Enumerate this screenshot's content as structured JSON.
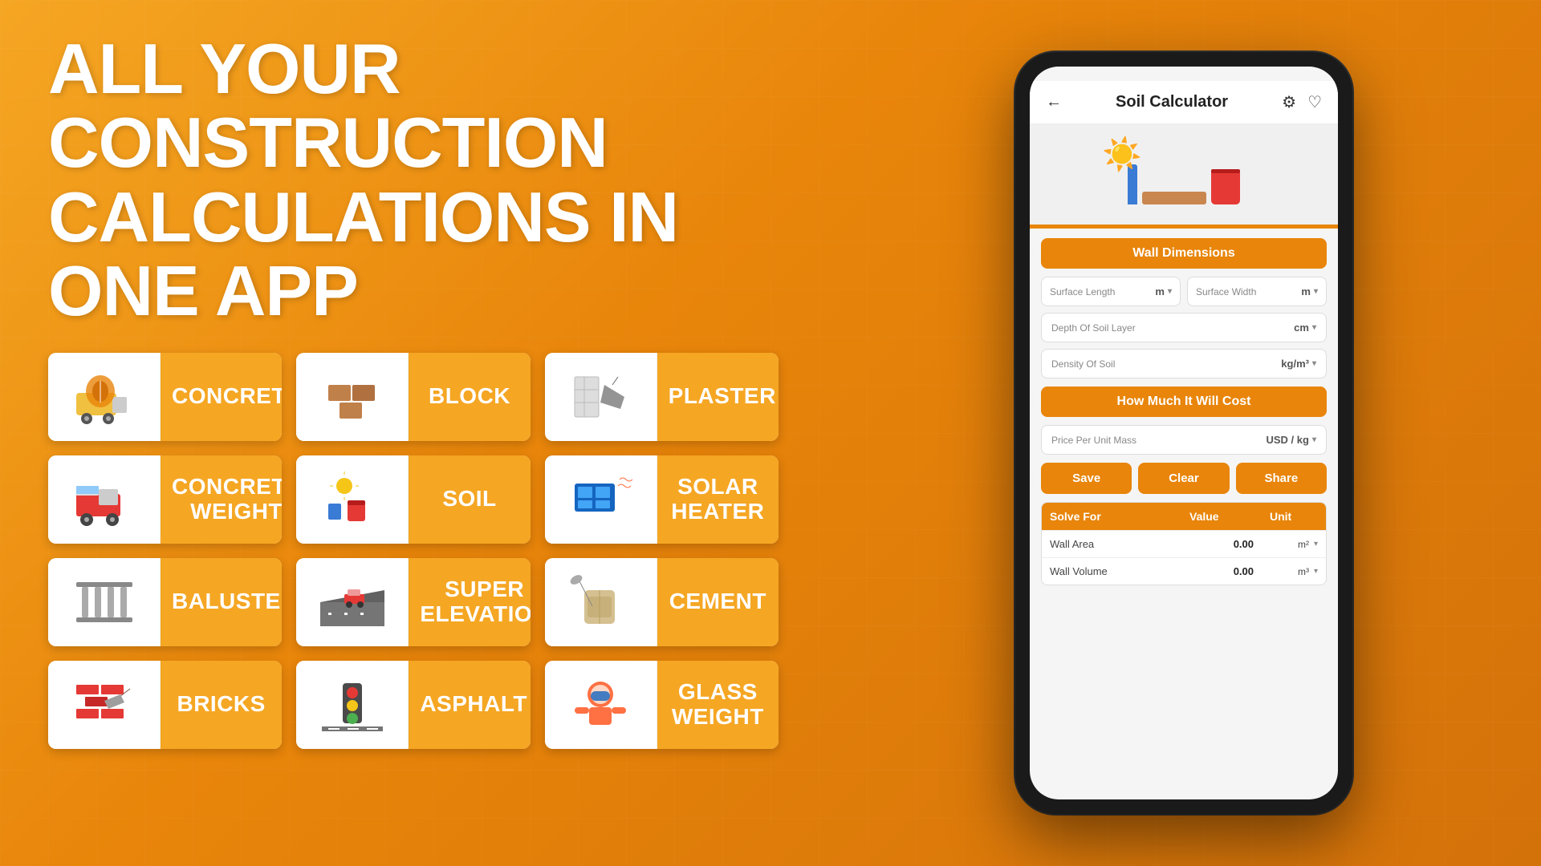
{
  "headline": {
    "line1": "ALL YOUR CONSTRUCTION",
    "line2": "CALCULATIONS IN ONE APP"
  },
  "cards": [
    {
      "id": "concrete",
      "label": "CONCRETE",
      "icon": "🏗️"
    },
    {
      "id": "block",
      "label": "BLOCK",
      "icon": "🧱"
    },
    {
      "id": "plaster",
      "label": "PLASTER",
      "icon": "🪣"
    },
    {
      "id": "concrete-weight",
      "label": "CONCRETE WEIGHT",
      "icon": "🚛"
    },
    {
      "id": "soil",
      "label": "SOIL",
      "icon": "🏺"
    },
    {
      "id": "solar-heater",
      "label": "SOLAR HEATER",
      "icon": "☀️"
    },
    {
      "id": "baluster",
      "label": "BALUSTER",
      "icon": "🚧"
    },
    {
      "id": "super-elevation",
      "label": "SUPER ELEVATION",
      "icon": "🛣️"
    },
    {
      "id": "cement",
      "label": "CEMENT",
      "icon": "💰"
    },
    {
      "id": "bricks",
      "label": "BRICKS",
      "icon": "🧱"
    },
    {
      "id": "asphalt",
      "label": "ASPHALT",
      "icon": "🚦"
    },
    {
      "id": "glass-weight",
      "label": "GLASS WEIGHT",
      "icon": "🪟"
    }
  ],
  "phone": {
    "title": "Soil Calculator",
    "back_icon": "←",
    "settings_icon": "⚙",
    "heart_icon": "♡",
    "wall_dimensions_label": "Wall Dimensions",
    "surface_length_placeholder": "Surface Length",
    "surface_length_unit": "m",
    "surface_width_placeholder": "Surface Width",
    "surface_width_unit": "m",
    "depth_of_soil_placeholder": "Depth Of Soil Layer",
    "depth_of_soil_unit": "cm",
    "density_of_soil_placeholder": "Density Of Soil",
    "density_of_soil_unit": "kg/m³",
    "how_much_label": "How Much It Will Cost",
    "price_per_unit_placeholder": "Price Per Unit Mass",
    "price_per_unit_unit": "USD / kg",
    "save_btn": "Save",
    "clear_btn": "Clear",
    "share_btn": "Share",
    "results_header": {
      "solve_for": "Solve For",
      "value": "Value",
      "unit": "Unit"
    },
    "results_rows": [
      {
        "label": "Wall Area",
        "value": "0.00",
        "unit": "m²"
      },
      {
        "label": "Wall Volume",
        "value": "0.00",
        "unit": "m³"
      }
    ]
  }
}
